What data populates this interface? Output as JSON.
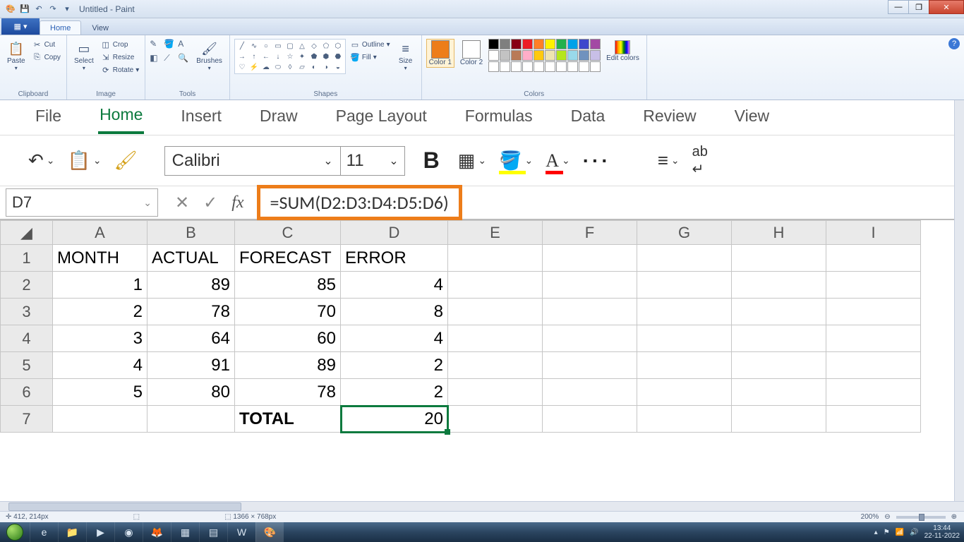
{
  "paint": {
    "title": "Untitled - Paint",
    "tabs": {
      "home": "Home",
      "view": "View"
    },
    "groups": {
      "clipboard": "Clipboard",
      "image": "Image",
      "tools": "Tools",
      "shapes": "Shapes",
      "colors": "Colors"
    },
    "buttons": {
      "paste": "Paste",
      "cut": "Cut",
      "copy": "Copy",
      "select": "Select",
      "crop": "Crop",
      "resize": "Resize",
      "rotate": "Rotate",
      "brushes": "Brushes",
      "outline": "Outline",
      "fill": "Fill",
      "size": "Size",
      "color1": "Color 1",
      "color2": "Color 2",
      "edit_colors": "Edit colors"
    },
    "status": {
      "coords": "412, 214px",
      "canvas_size": "1366 × 768px",
      "zoom": "200%"
    }
  },
  "excel": {
    "tabs": [
      "File",
      "Home",
      "Insert",
      "Draw",
      "Page Layout",
      "Formulas",
      "Data",
      "Review",
      "View"
    ],
    "active_tab": "Home",
    "font_name": "Calibri",
    "font_size": "11",
    "name_box": "D7",
    "formula": "=SUM(D2:D3:D4:D5:D6)",
    "columns": [
      "A",
      "B",
      "C",
      "D",
      "E",
      "F",
      "G",
      "H",
      "I"
    ],
    "headers": {
      "A": "MONTH",
      "B": "ACTUAL",
      "C": "FORECAST",
      "D": "ERROR"
    },
    "rows": [
      {
        "r": "2",
        "A": "1",
        "B": "89",
        "C": "85",
        "D": "4"
      },
      {
        "r": "3",
        "A": "2",
        "B": "78",
        "C": "70",
        "D": "8"
      },
      {
        "r": "4",
        "A": "3",
        "B": "64",
        "C": "60",
        "D": "4"
      },
      {
        "r": "5",
        "A": "4",
        "B": "91",
        "C": "89",
        "D": "2"
      },
      {
        "r": "6",
        "A": "5",
        "B": "80",
        "C": "78",
        "D": "2"
      }
    ],
    "total_row": {
      "r": "7",
      "C": "TOTAL",
      "D": "20"
    }
  },
  "taskbar": {
    "time": "13:44",
    "date": "22-11-2022"
  }
}
